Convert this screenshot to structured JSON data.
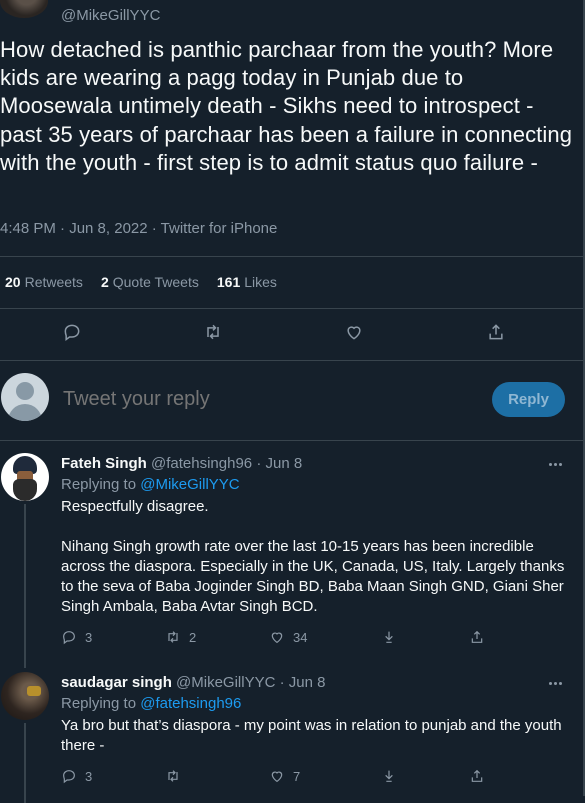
{
  "tweet": {
    "handle": "@MikeGillYYC",
    "text": "How detached is panthic parchaar from the youth? More kids are wearing a pagg today in Punjab due to Moosewala untimely death - Sikhs need to introspect - past 35 years of parchaar has been a failure in connecting with the youth - first step is to admit status quo failure -",
    "meta": "4:48 PM · Jun 8, 2022 · Twitter for iPhone",
    "stats": {
      "retweets_count": "20",
      "retweets_label": "Retweets",
      "quotes_count": "2",
      "quotes_label": "Quote Tweets",
      "likes_count": "161",
      "likes_label": "Likes"
    }
  },
  "composer": {
    "placeholder": "Tweet your reply",
    "button_label": "Reply"
  },
  "replies": [
    {
      "name": "Fateh Singh",
      "meta": "@fatehsingh96 · Jun 8",
      "replying_prefix": "Replying to",
      "replying_to": "@MikeGillYYC",
      "paragraphs": [
        "Respectfully disagree.",
        "Nihang Singh growth rate over the last 10-15 years has been incredible across the diaspora. Especially in the UK, Canada, US, Italy. Largely thanks to the seva of Baba Joginder Singh BD, Baba Maan Singh GND, Giani Sher Singh Ambala, Baba Avtar Singh BCD."
      ],
      "replies_count": "3",
      "retweets_count": "2",
      "likes_count": "34"
    },
    {
      "name": "saudagar singh",
      "meta": "@MikeGillYYC · Jun 8",
      "replying_prefix": "Replying to",
      "replying_to": "@fatehsingh96",
      "paragraphs": [
        "Ya bro but that’s diaspora - my point was in relation to punjab and the youth there -"
      ],
      "replies_count": "3",
      "retweets_count": "",
      "likes_count": "7"
    }
  ],
  "icons": [
    "reply-icon",
    "retweet-icon",
    "like-icon",
    "share-icon",
    "download-icon",
    "more-icon"
  ],
  "colors": {
    "background": "#15202b",
    "accent": "#1d9bf0",
    "muted": "#8b98a5",
    "border": "#38444d",
    "reply_button": "#1d6fa5"
  }
}
